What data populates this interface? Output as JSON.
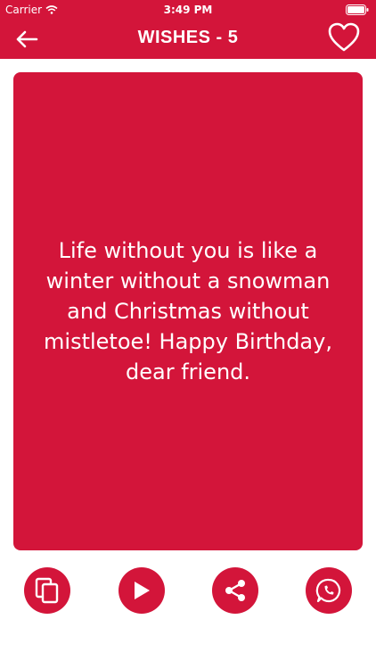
{
  "status": {
    "carrier": "Carrier",
    "time": "3:49 PM"
  },
  "header": {
    "title": "WISHES - 5"
  },
  "wish": {
    "text": "Life without you is like a winter without a snowman and Christmas without mistletoe! Happy Birthday, dear friend."
  },
  "icons": {
    "back": "arrow-left-icon",
    "favorite": "heart-outline-icon",
    "copy": "copy-icon",
    "play": "play-icon",
    "share": "share-icon",
    "whatsapp": "whatsapp-icon"
  },
  "colors": {
    "accent": "#d3153a",
    "text_on_accent": "#ffffff"
  }
}
